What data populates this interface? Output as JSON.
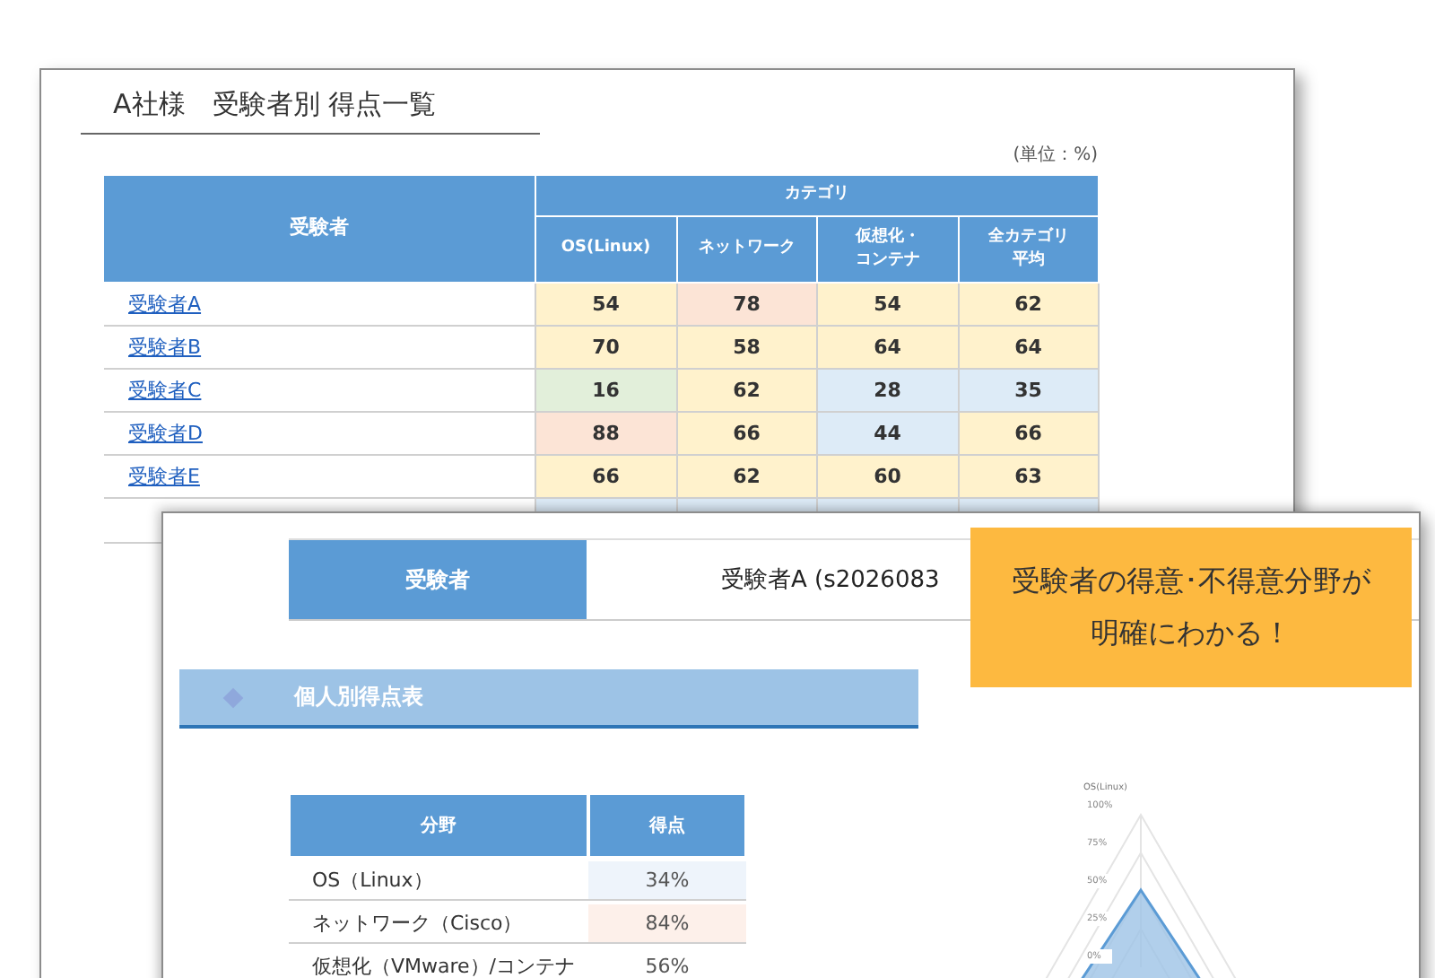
{
  "summary_sheet": {
    "title": "A社様　受験者別 得点一覧",
    "unit": "(単位：%)",
    "header": {
      "name_column": "受験者",
      "group": "カテゴリ",
      "columns": [
        [
          "OS(Linux)"
        ],
        [
          "ネットワーク"
        ],
        [
          "仮想化・",
          "コンテナ"
        ],
        [
          "全カテゴリ",
          "平均"
        ]
      ]
    },
    "rows": [
      {
        "name": "受験者A",
        "cells": [
          {
            "value": "54",
            "color": "#fff2cc"
          },
          {
            "value": "78",
            "color": "#fce4d6"
          },
          {
            "value": "54",
            "color": "#fff2cc"
          },
          {
            "value": "62",
            "color": "#fff2cc"
          }
        ]
      },
      {
        "name": "受験者B",
        "cells": [
          {
            "value": "70",
            "color": "#fff2cc"
          },
          {
            "value": "58",
            "color": "#fff2cc"
          },
          {
            "value": "64",
            "color": "#fff2cc"
          },
          {
            "value": "64",
            "color": "#fff2cc"
          }
        ]
      },
      {
        "name": "受験者C",
        "cells": [
          {
            "value": "16",
            "color": "#e2efda"
          },
          {
            "value": "62",
            "color": "#fff2cc"
          },
          {
            "value": "28",
            "color": "#ddebf7"
          },
          {
            "value": "35",
            "color": "#ddebf7"
          }
        ]
      },
      {
        "name": "受験者D",
        "cells": [
          {
            "value": "88",
            "color": "#fce4d6"
          },
          {
            "value": "66",
            "color": "#fff2cc"
          },
          {
            "value": "44",
            "color": "#ddebf7"
          },
          {
            "value": "66",
            "color": "#fff2cc"
          }
        ]
      },
      {
        "name": "受験者E",
        "cells": [
          {
            "value": "66",
            "color": "#fff2cc"
          },
          {
            "value": "62",
            "color": "#fff2cc"
          },
          {
            "value": "60",
            "color": "#fff2cc"
          },
          {
            "value": "63",
            "color": "#fff2cc"
          }
        ]
      }
    ]
  },
  "individual_sheet": {
    "examinee": {
      "label": "受験者",
      "value": "受験者A (s2026083"
    },
    "section_title": "個人別得点表",
    "score_table": {
      "columns": [
        "分野",
        "得点"
      ],
      "rows": [
        {
          "field": "OS（Linux）",
          "score": "34%",
          "color": "#eef4fb"
        },
        {
          "field": "ネットワーク（Cisco）",
          "score": "84%",
          "color": "#fdf0ea"
        },
        {
          "field": "仮想化（VMware）/コンテナ",
          "score": "56%",
          "color": "#ffffff"
        }
      ]
    },
    "radar": {
      "axis_label": "OS(Linux)",
      "ticks": [
        "100%",
        "75%",
        "50%",
        "25%",
        "0%"
      ]
    }
  },
  "callout": {
    "lines": [
      "受験者の得意･不得意分野が",
      "明確にわかる！"
    ]
  }
}
